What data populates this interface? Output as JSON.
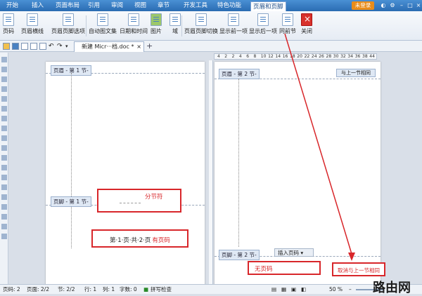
{
  "menu": {
    "tabs": [
      "开始",
      "插入",
      "页面布局",
      "引用",
      "审阅",
      "视图",
      "章节",
      "开发工具",
      "特色功能",
      "页眉和页脚"
    ],
    "active_index": 9,
    "login_label": "未登录"
  },
  "ribbon": {
    "page_number": "页码",
    "header_style": "页眉横线",
    "header_footer_options": "页眉页脚选项",
    "autotext": "自动图文集",
    "date_time": "日期和时间",
    "picture": "图片",
    "field": "域",
    "switch_header_footer": "页眉页脚切换",
    "show_previous": "显示前一项",
    "show_next": "显示后一项",
    "same_as_previous": "同前节",
    "close": "关闭"
  },
  "document_tab": "新建 Micr···档.doc *",
  "new_tab_symbol": "+",
  "ruler_numbers": [
    "4",
    "2",
    "2",
    "4",
    "6",
    "8",
    "10",
    "12",
    "14",
    "16",
    "18",
    "20",
    "22",
    "24",
    "26",
    "28",
    "30",
    "32",
    "34",
    "36",
    "38",
    "44"
  ],
  "page1": {
    "header_label": "页眉 - 第 1 节-",
    "footer_label": "页脚 - 第 1 节-",
    "page_text": "第·1·页·共·2·页",
    "section_break_note": "分节符",
    "page_number_note": "有页码"
  },
  "page2": {
    "header_label": "页眉 - 第 2 节-",
    "header_same": "与上一节相同",
    "footer_label": "页脚 - 第 2 节-",
    "insert_page_number": "插入页码 ▾",
    "no_page_number_note": "无页码",
    "unlink_note": "取消与上一节相同"
  },
  "status": {
    "page_num": "页码: 2",
    "pages": "页面: 2/2",
    "section": "节: 2/2",
    "row": "行: 1",
    "col": "列: 1",
    "words": "字数: 0",
    "spell": "拼写检查",
    "zoom": "50 %"
  },
  "watermark": "路由网",
  "colors": {
    "accent": "#2a6cb2",
    "annotation_red": "#d8262a",
    "login_orange": "#e98c1a"
  }
}
